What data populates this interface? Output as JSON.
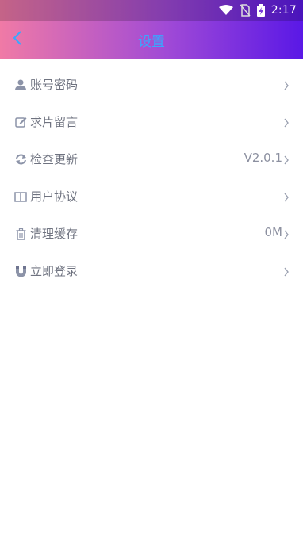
{
  "statusbar": {
    "time": "2:17"
  },
  "header": {
    "title": "设置"
  },
  "settings": {
    "items": [
      {
        "label": "账号密码",
        "value": "",
        "icon": "user-icon"
      },
      {
        "label": "求片留言",
        "value": "",
        "icon": "edit-icon"
      },
      {
        "label": "检查更新",
        "value": "V2.0.1",
        "icon": "refresh-icon"
      },
      {
        "label": "用户协议",
        "value": "",
        "icon": "book-icon"
      },
      {
        "label": "清理缓存",
        "value": "0M",
        "icon": "trash-icon"
      },
      {
        "label": "立即登录",
        "value": "",
        "icon": "magnet-icon"
      }
    ]
  },
  "colors": {
    "icon": "#8c93a8",
    "title": "#39a7ff",
    "label": "#6f7380"
  }
}
